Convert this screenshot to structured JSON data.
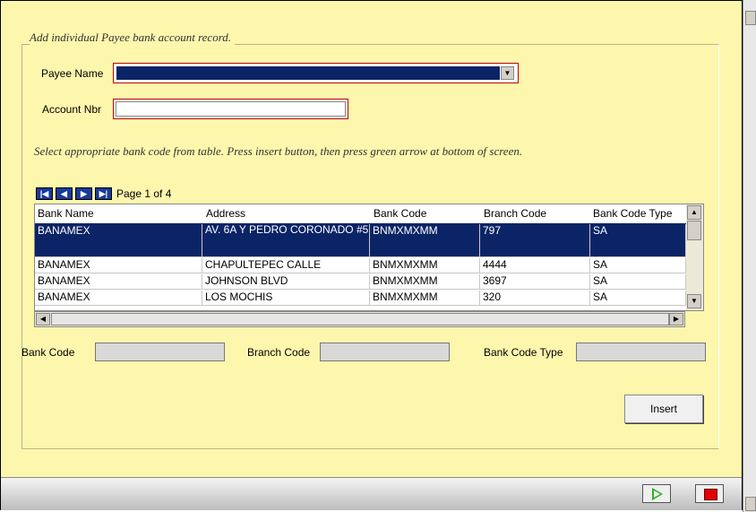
{
  "form": {
    "legend": "Add individual Payee bank account record.",
    "payee_label": "Payee Name",
    "payee_value": "",
    "account_label": "Account Nbr",
    "account_value": "",
    "instructions": "Select appropriate bank code from table. Press insert button, then press green arrow at bottom of screen."
  },
  "pager": {
    "text": "Page 1 of 4",
    "buttons": [
      "first-page",
      "previous-page",
      "next-page",
      "last-page"
    ]
  },
  "table": {
    "columns": [
      "Bank Name",
      "Address",
      "Bank Code",
      "Branch Code",
      "Bank Code Type"
    ],
    "rows": [
      {
        "bank_name": "BANAMEX",
        "address": "AV. 6A Y PEDRO CORONADO #5",
        "bank_code": "BNMXMXMM",
        "branch_code": "797",
        "bank_code_type": "SA",
        "selected": true
      },
      {
        "bank_name": "BANAMEX",
        "address": "CHAPULTEPEC CALLE",
        "bank_code": "BNMXMXMM",
        "branch_code": "4444",
        "bank_code_type": "SA",
        "selected": false
      },
      {
        "bank_name": "BANAMEX",
        "address": "JOHNSON BLVD",
        "bank_code": "BNMXMXMM",
        "branch_code": "3697",
        "bank_code_type": "SA",
        "selected": false
      },
      {
        "bank_name": "BANAMEX",
        "address": "LOS MOCHIS",
        "bank_code": "BNMXMXMM",
        "branch_code": "320",
        "bank_code_type": "SA",
        "selected": false
      }
    ]
  },
  "detail": {
    "bank_code_label": "Bank Code",
    "bank_code_value": "",
    "branch_code_label": "Branch Code",
    "branch_code_value": "",
    "bank_code_type_label": "Bank Code Type",
    "bank_code_type_value": ""
  },
  "actions": {
    "insert_label": "Insert",
    "next_icon": "green-play-arrow-icon",
    "stop_icon": "red-stop-icon"
  },
  "colors": {
    "background": "#fdf7ad",
    "selection": "#0b2466",
    "required_border": "#c00000"
  }
}
